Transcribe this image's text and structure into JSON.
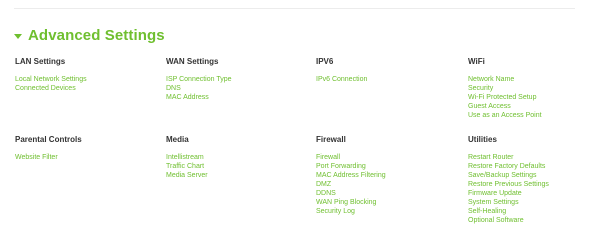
{
  "colors": {
    "accent": "#6fbf2f",
    "heading": "#333333",
    "background": "#ffffff"
  },
  "section": {
    "title": "Advanced Settings",
    "toggle_icon": "triangle-down-icon"
  },
  "groups": [
    {
      "heading": "LAN Settings",
      "links": [
        "Local Network Settings",
        "Connected Devices"
      ]
    },
    {
      "heading": "WAN Settings",
      "links": [
        "ISP Connection Type",
        "DNS",
        "MAC Address"
      ]
    },
    {
      "heading": "IPV6",
      "links": [
        "IPv6 Connection"
      ]
    },
    {
      "heading": "WiFi",
      "links": [
        "Network Name",
        "Security",
        "Wi-Fi Protected Setup",
        "Guest Access",
        "Use as an Access Point"
      ]
    },
    {
      "heading": "Parental Controls",
      "links": [
        "Website Filter"
      ]
    },
    {
      "heading": "Media",
      "links": [
        "Intellistream",
        "Traffic Chart",
        "Media Server"
      ]
    },
    {
      "heading": "Firewall",
      "links": [
        "Firewall",
        "Port Forwarding",
        "MAC Address Filtering",
        "DMZ",
        "DDNS",
        "WAN Ping Blocking",
        "Security Log"
      ]
    },
    {
      "heading": "Utilities",
      "links": [
        "Restart Router",
        "Restore Factory Defaults",
        "Save/Backup Settings",
        "Restore Previous Settings",
        "Firmware Update",
        "System Settings",
        "Self-Healing",
        "Optional Software"
      ]
    }
  ]
}
